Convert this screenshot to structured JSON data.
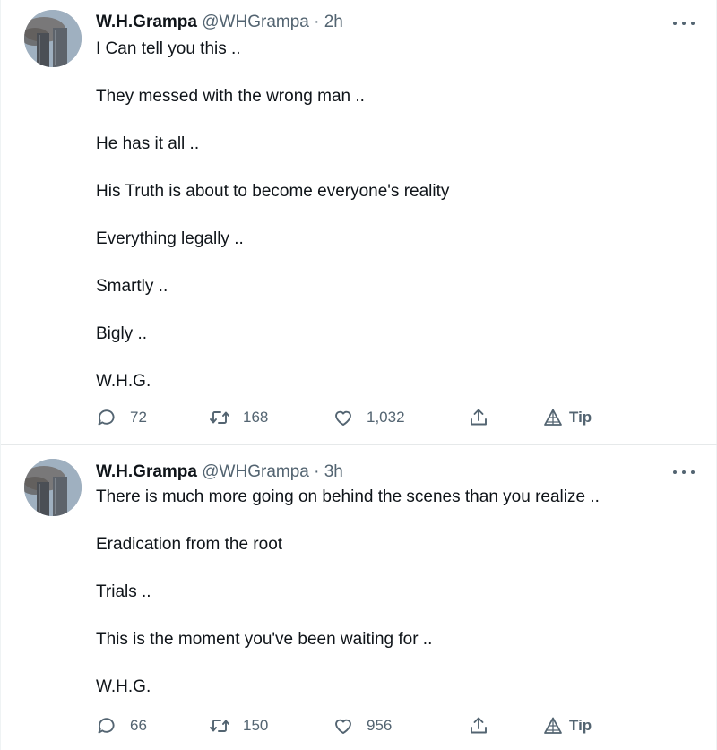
{
  "tweets": [
    {
      "name": "W.H.Grampa",
      "handle": "@WHGrampa",
      "separator": "·",
      "time": "2h",
      "lines": [
        "I Can tell you this ..",
        "They messed with the wrong man ..",
        "He has it all ..",
        "His Truth is about to become everyone's reality",
        "Everything legally ..",
        "Smartly ..",
        "Bigly ..",
        "W.H.G."
      ],
      "replies": "72",
      "retweets": "168",
      "likes": "1,032",
      "tip_label": "Tip"
    },
    {
      "name": "W.H.Grampa",
      "handle": "@WHGrampa",
      "separator": "·",
      "time": "3h",
      "lines": [
        "There is much more going on behind the scenes than you realize ..",
        "Eradication from the root",
        "Trials ..",
        "This is the moment you've been waiting for ..",
        "W.H.G."
      ],
      "replies": "66",
      "retweets": "150",
      "likes": "956",
      "tip_label": "Tip"
    }
  ],
  "icons": {
    "reply": "reply-icon",
    "retweet": "retweet-icon",
    "like": "heart-icon",
    "share": "share-icon",
    "tip": "tip-icon",
    "more": "more-dots-icon"
  },
  "colors": {
    "text_primary": "#0f1419",
    "text_secondary": "#536471",
    "divider": "#e6e9ea"
  }
}
